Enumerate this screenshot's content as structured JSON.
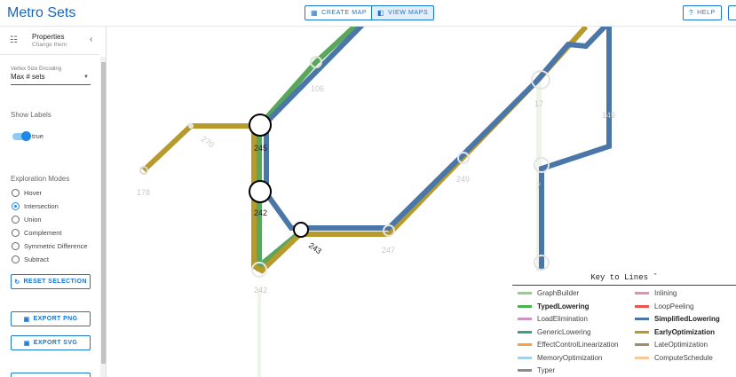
{
  "header": {
    "title": "Metro Sets",
    "create_map": "CREATE MAP",
    "view_maps": "VIEW MAPS",
    "help": "HELP"
  },
  "sidebar": {
    "title": "Properties",
    "subtitle": "Change them",
    "vertex_size_label": "Vertex Size Encoding",
    "vertex_size_value": "Max # sets",
    "show_labels_label": "Show Labels",
    "show_labels_value": "true",
    "exploration_label": "Exploration Modes",
    "modes": [
      "Hover",
      "Intersection",
      "Union",
      "Complement",
      "Symmetric Difference",
      "Subtract"
    ],
    "selected_mode": "Intersection",
    "reset_label": "RESET SELECTION",
    "export_png": "EXPORT PNG",
    "export_svg": "EXPORT SVG"
  },
  "map": {
    "station_labels": [
      "106",
      "270",
      "245",
      "178",
      "242",
      "243",
      "247",
      "249",
      "17",
      "149",
      "242",
      "7"
    ]
  },
  "legend": {
    "title": "Key to Lines ˇ",
    "items": [
      {
        "name": "GraphBuilder",
        "color": "#8fd18a",
        "bold": false
      },
      {
        "name": "Inlining",
        "color": "#e88fa8",
        "bold": false
      },
      {
        "name": "TypedLowering",
        "color": "#4caf50",
        "bold": true
      },
      {
        "name": "LoopPeeling",
        "color": "#ef5350",
        "bold": false
      },
      {
        "name": "LoadElimination",
        "color": "#c795c7",
        "bold": false
      },
      {
        "name": "SimplifiedLowering",
        "color": "#4a76a8",
        "bold": true
      },
      {
        "name": "GenericLowering",
        "color": "#3e9e8a",
        "bold": false
      },
      {
        "name": "EarlyOptimization",
        "color": "#b69a2c",
        "bold": true
      },
      {
        "name": "EffectControlLinearization",
        "color": "#f4a14b",
        "bold": false
      },
      {
        "name": "LateOptimization",
        "color": "#a88a6a",
        "bold": false
      },
      {
        "name": "MemoryOptimization",
        "color": "#a8d0e8",
        "bold": false
      },
      {
        "name": "ComputeSchedule",
        "color": "#f7c89a",
        "bold": false
      },
      {
        "name": "Typer",
        "color": "#8c8c8c",
        "bold": false
      }
    ]
  },
  "colors": {
    "accent": "#1976d2",
    "blue_line": "#4a76a8",
    "gold_line": "#b69a2c",
    "green_line": "#5aa65a"
  }
}
